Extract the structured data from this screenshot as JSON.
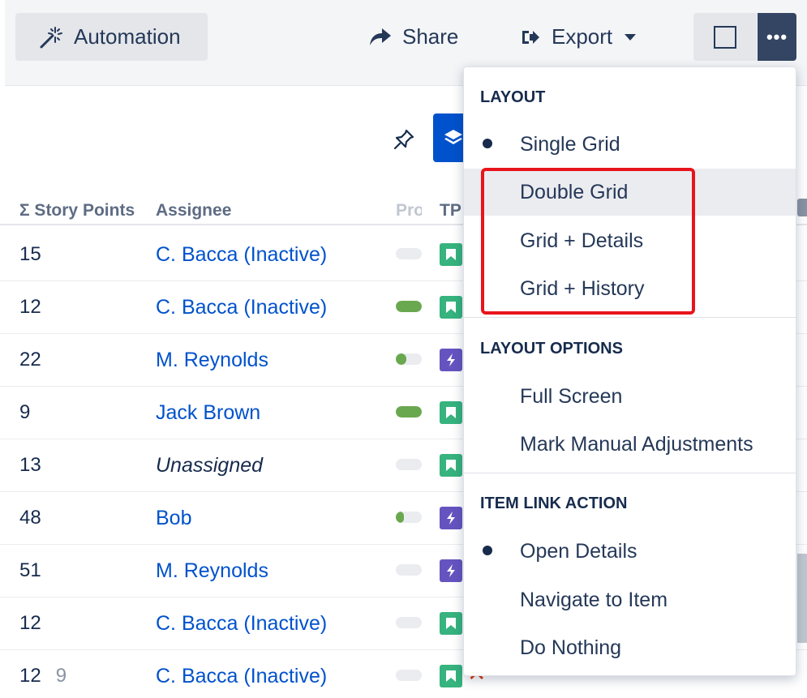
{
  "toolbar": {
    "automation_label": "Automation",
    "share_label": "Share",
    "export_label": "Export",
    "more_label": "•••"
  },
  "grid": {
    "columns": {
      "story_points": "Σ Story Points",
      "assignee": "Assignee",
      "progress": "Progress",
      "type": "TP"
    },
    "rows": [
      {
        "story_points": "15",
        "assignee": "C. Bacca (Inactive)",
        "progress": 0,
        "type": "story"
      },
      {
        "story_points": "12",
        "assignee": "C. Bacca (Inactive)",
        "progress": 1,
        "type": "story"
      },
      {
        "story_points": "22",
        "assignee": "M. Reynolds",
        "progress": 0.4,
        "type": "epic"
      },
      {
        "story_points": "9",
        "assignee": "Jack Brown",
        "progress": 1,
        "type": "story"
      },
      {
        "story_points": "13",
        "assignee": "Unassigned",
        "progress": 0,
        "type": "story"
      },
      {
        "story_points": "48",
        "assignee": "Bob",
        "progress": 0.3,
        "type": "epic"
      },
      {
        "story_points": "51",
        "assignee": "M. Reynolds",
        "progress": 0,
        "type": "epic"
      },
      {
        "story_points": "12",
        "assignee": "C. Bacca (Inactive)",
        "progress": 0,
        "type": "story"
      },
      {
        "story_points": "12",
        "story_points_sub": "9",
        "assignee": "C. Bacca (Inactive)",
        "progress": 0,
        "type": "story"
      }
    ]
  },
  "menu": {
    "layout_title": "LAYOUT",
    "single_grid": "Single Grid",
    "double_grid": "Double Grid",
    "grid_details": "Grid + Details",
    "grid_history": "Grid + History",
    "layout_options_title": "LAYOUT OPTIONS",
    "full_screen": "Full Screen",
    "mark_manual": "Mark Manual Adjustments",
    "item_link_title": "ITEM LINK ACTION",
    "open_details": "Open Details",
    "navigate_item": "Navigate to Item",
    "do_nothing": "Do Nothing"
  },
  "colors": {
    "accent": "#0052cc",
    "highlight": "#e8141c",
    "story": "#36b37e",
    "epic": "#6554c0"
  }
}
